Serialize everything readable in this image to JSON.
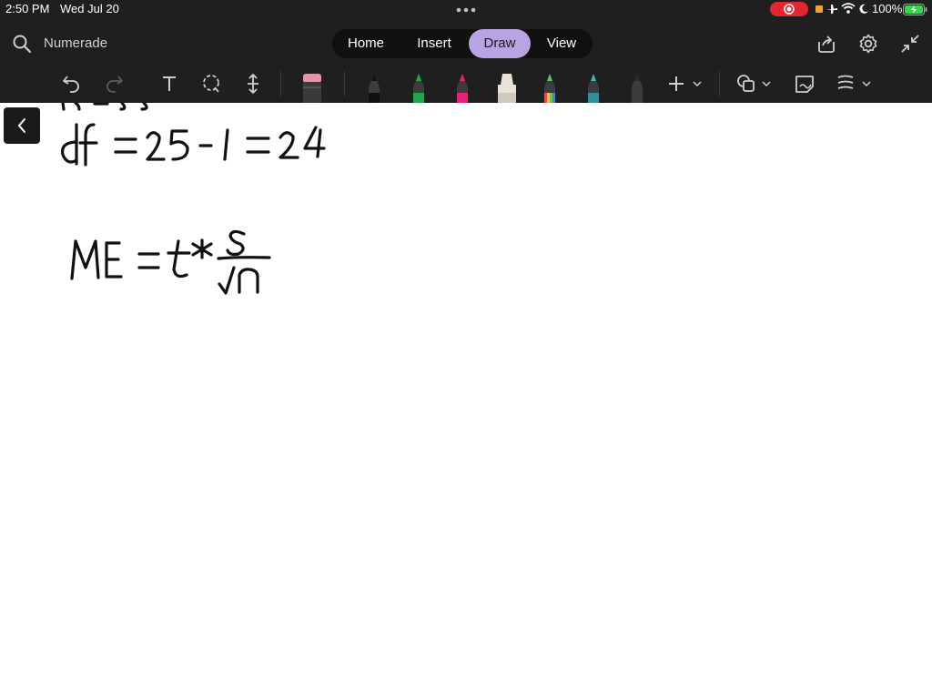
{
  "status": {
    "time": "2:50 PM",
    "date": "Wed Jul 20",
    "battery": "100%"
  },
  "app": {
    "title": "Numerade"
  },
  "tabs": [
    {
      "label": "Home",
      "active": false
    },
    {
      "label": "Insert",
      "active": false
    },
    {
      "label": "Draw",
      "active": true
    },
    {
      "label": "View",
      "active": false
    }
  ],
  "colors": {
    "toolbar_bg": "#1f1f1f",
    "active_tab": "#b9a3e3",
    "recording": "#e5262e",
    "battery": "#32d74b"
  },
  "pens": [
    {
      "name": "black-pen",
      "tip": "#111111"
    },
    {
      "name": "green-pen",
      "tip": "#1fa84a"
    },
    {
      "name": "pink-pen",
      "tip": "#e8207a"
    },
    {
      "name": "highlighter",
      "tip": "#e9e2d6"
    },
    {
      "name": "rainbow-pen",
      "tip": "#5fc35f"
    },
    {
      "name": "galaxy-pen",
      "tip": "#3fb8a8"
    },
    {
      "name": "gray-pen",
      "tip": "#2a2a2a"
    }
  ]
}
